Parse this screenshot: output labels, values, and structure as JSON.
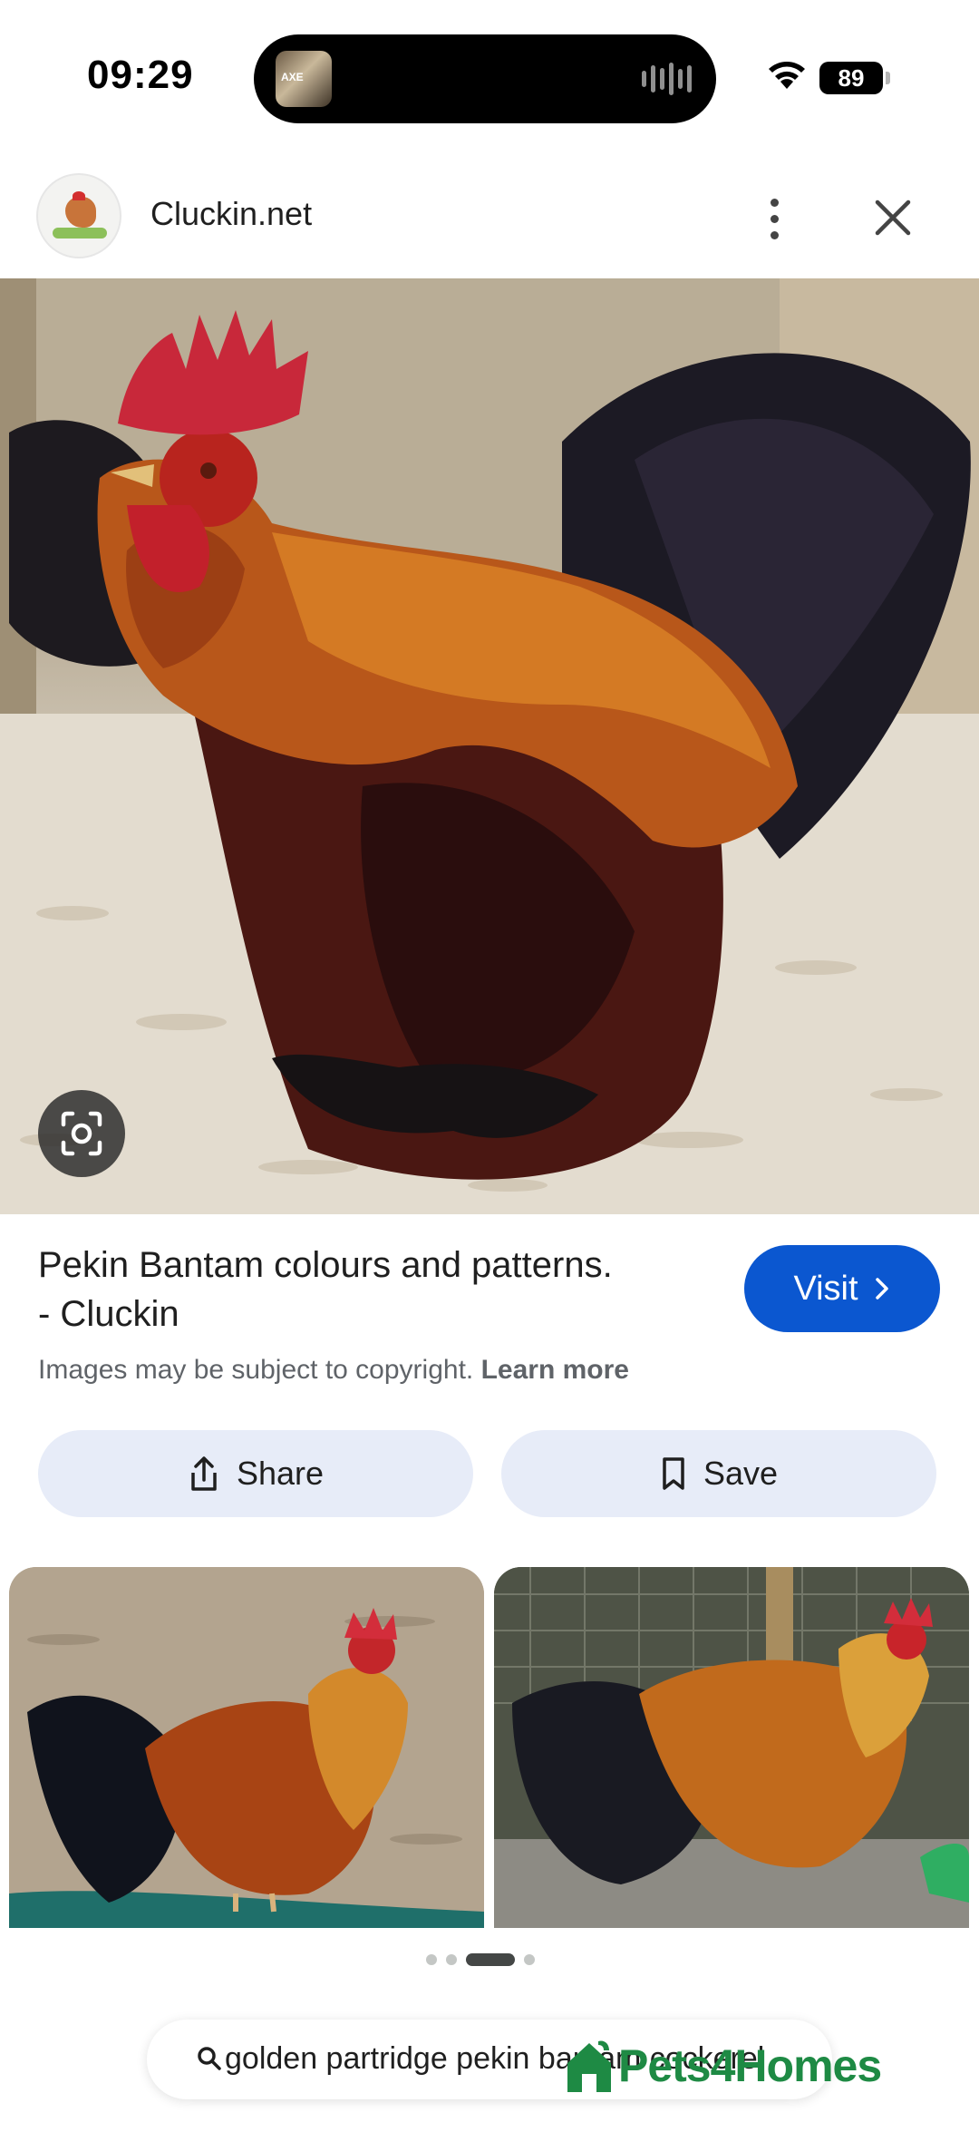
{
  "status_bar": {
    "time": "09:29",
    "battery": "89",
    "island_thumb_text": "AXE"
  },
  "header": {
    "site_name": "Cluckin.net"
  },
  "result": {
    "title_line1": "Pekin Bantam colours and patterns.",
    "title_line2": "- Cluckin",
    "visit_label": "Visit",
    "copyright_text": "Images may be subject to copyright.",
    "learn_more": "Learn more"
  },
  "actions": {
    "share_label": "Share",
    "save_label": "Save"
  },
  "carousel": {
    "dot_count": 4,
    "active_index": 2
  },
  "bottom": {
    "search_text": "golden partridge pekin bantam cockerel",
    "brand": "Pets4Homes"
  },
  "colors": {
    "accent": "#0b57d0",
    "chip_background": "#e7ecf8",
    "brand_green": "#1e8a44"
  },
  "icons": [
    "wifi-icon",
    "more-vert-icon",
    "close-icon",
    "lens-icon",
    "share-icon",
    "bookmark-icon",
    "chevron-right-icon",
    "search-icon"
  ]
}
